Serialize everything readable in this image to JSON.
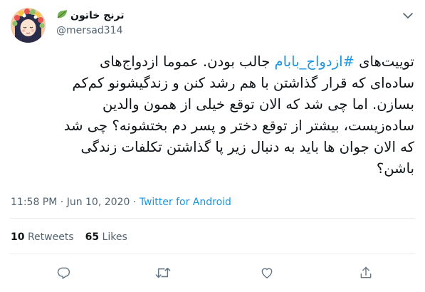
{
  "user": {
    "display_name": "ترنج خاتون",
    "name_emoji": "leaf-emoji",
    "handle": "@mersad314",
    "avatar": "flower-wreath-girl-avatar"
  },
  "tweet": {
    "line1_before": "توییت‌های ",
    "hashtag": "#ازدواج_بابام",
    "line1_after": " جالب بودن. عموما ازدواج‌های",
    "line2": "ساده‌ای که قرار گذاشتن با هم رشد کنن و زندگیشونو کم‌کم",
    "line3": "بسازن. اما چی شد که الان توقع خیلی از همون والدین",
    "line4": "ساده‌زیست، بیشتر از توقع دختر و پسر دم بختشونه؟ چی شد",
    "line5": "که الان جوان ها باید به دنبال زیر پا گذاشتن تکلفات زندگی",
    "line6": "باشن؟"
  },
  "meta": {
    "time": "11:58 PM",
    "separator": " · ",
    "date": "Jun 10, 2020",
    "source": "Twitter for Android"
  },
  "stats": {
    "retweets_count": "10",
    "retweets_label": "Retweets",
    "likes_count": "65",
    "likes_label": "Likes"
  },
  "icons": {
    "caret": "chevron-down-icon",
    "reply": "reply-icon",
    "retweet": "retweet-icon",
    "like": "heart-icon",
    "share": "share-icon"
  },
  "colors": {
    "link": "#1b95e0",
    "secondary_text": "#536471",
    "divider": "#e6ecf0"
  }
}
